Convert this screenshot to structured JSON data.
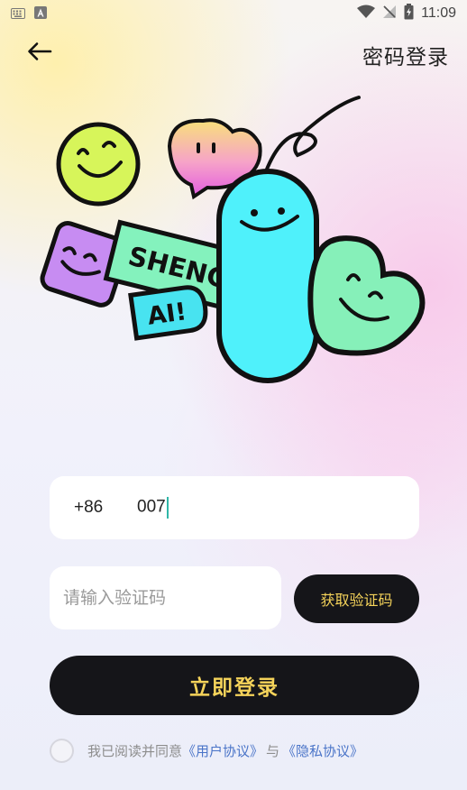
{
  "status_bar": {
    "time": "11:09",
    "left_icons": [
      "keyboard-icon",
      "app-notification-icon"
    ],
    "right_icons": [
      "wifi-icon",
      "no-signal-icon",
      "battery-icon"
    ]
  },
  "header": {
    "back_icon": "arrow-left-icon",
    "password_login": "密码登录"
  },
  "illustration": {
    "sticker_line1": "SHENG",
    "sticker_line2": "AI!"
  },
  "phone": {
    "country_code": "+86",
    "value": "007"
  },
  "code": {
    "placeholder": "请输入验证码",
    "get_code_label": "获取验证码"
  },
  "login": {
    "label": "立即登录"
  },
  "agreement": {
    "prefix": "我已阅读并同意",
    "user_agreement": "《用户协议》",
    "connector": "与",
    "privacy_agreement": "《隐私协议》"
  },
  "colors": {
    "button_bg": "#151519",
    "button_text": "#f5d35a",
    "link": "#4a74c8"
  }
}
